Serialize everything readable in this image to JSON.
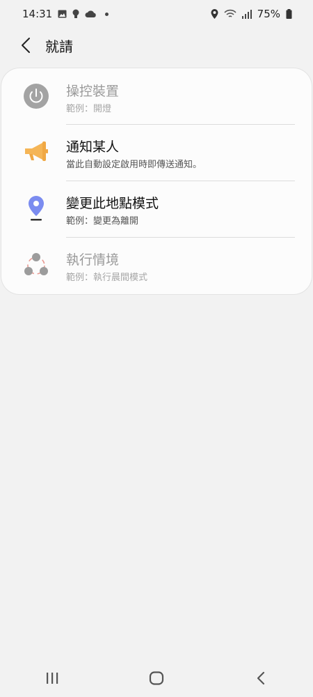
{
  "status_bar": {
    "time": "14:31",
    "battery": "75%",
    "left_icons": [
      "gallery-icon",
      "bulb-icon",
      "cloud-icon",
      "dot-icon"
    ],
    "right_icons": [
      "location-icon",
      "wifi-icon",
      "signal-icon",
      "battery-icon"
    ]
  },
  "header": {
    "title": "就請"
  },
  "items": [
    {
      "title": "操控裝置",
      "subtitle": "範例：開燈",
      "icon": "power-icon",
      "enabled": false
    },
    {
      "title": "通知某人",
      "subtitle": "當此自動設定啟用時即傳送通知。",
      "icon": "megaphone-icon",
      "enabled": true
    },
    {
      "title": "變更此地點模式",
      "subtitle": "範例：變更為離開",
      "icon": "location-pin-icon",
      "enabled": true
    },
    {
      "title": "執行情境",
      "subtitle": "範例：執行晨間模式",
      "icon": "scene-icon",
      "enabled": false
    }
  ],
  "nav": {
    "icons": [
      "recents-icon",
      "home-icon",
      "back-icon"
    ]
  },
  "colors": {
    "background": "#f2f2f2",
    "card": "#fcfcfc",
    "megaphone": "#f5b556",
    "pin": "#7b8cf0",
    "disabled_gray": "#9a9a9a",
    "scene_accent": "#e89a92"
  }
}
